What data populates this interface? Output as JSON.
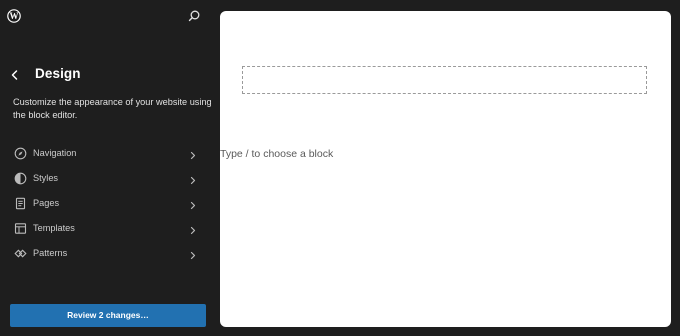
{
  "sidebar": {
    "title": "Design",
    "description": "Customize the appearance of your website using the block editor.",
    "items": [
      {
        "label": "Navigation",
        "icon": "navigation-icon"
      },
      {
        "label": "Styles",
        "icon": "styles-icon"
      },
      {
        "label": "Pages",
        "icon": "pages-icon"
      },
      {
        "label": "Templates",
        "icon": "templates-icon"
      },
      {
        "label": "Patterns",
        "icon": "patterns-icon"
      }
    ],
    "review_button": "Review 2 changes…"
  },
  "canvas": {
    "appender_placeholder": "Type / to choose a block"
  },
  "colors": {
    "sidebar_bg": "#1e1e1e",
    "accent": "#2271b1",
    "canvas_bg": "#ffffff"
  }
}
